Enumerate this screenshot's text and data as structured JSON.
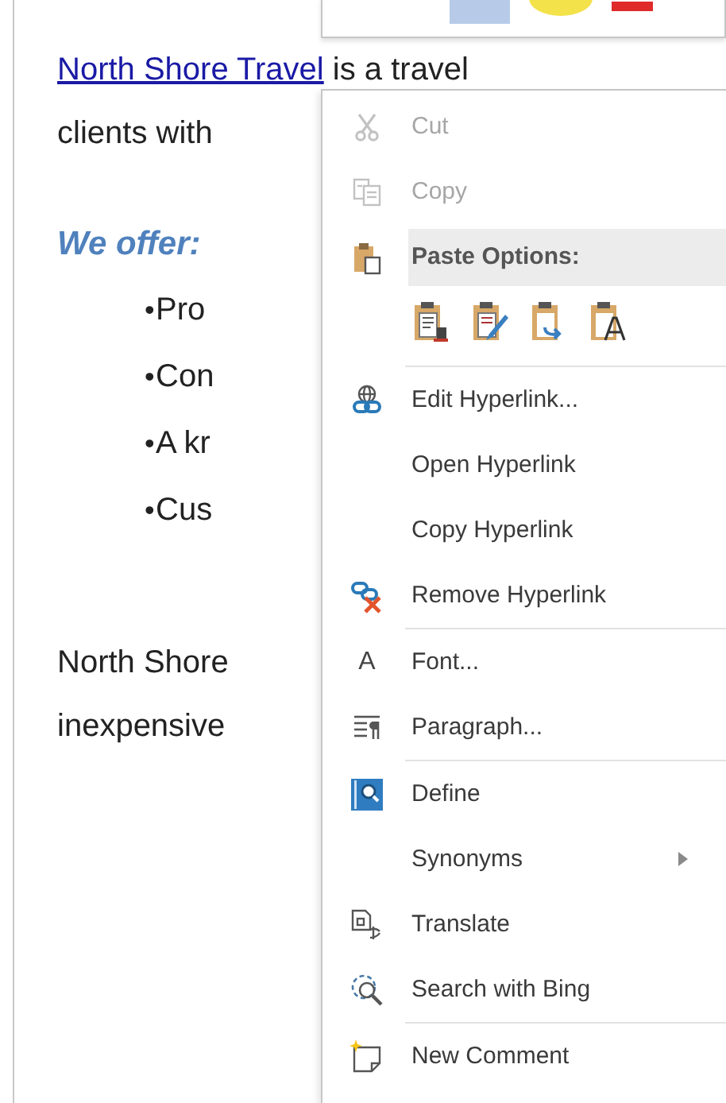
{
  "document": {
    "lines": [
      {
        "kind": "link",
        "link": "North Shore Travel",
        "text": "is a travel"
      },
      {
        "kind": "plain",
        "text": "clients with"
      },
      {
        "kind": "heading",
        "text": "We offer:"
      },
      {
        "kind": "bullet",
        "bullet": "•",
        "text": "Pro"
      },
      {
        "kind": "bullet",
        "bullet": "•",
        "text": "Con"
      },
      {
        "kind": "bullet",
        "bullet": "•",
        "text": "A kr"
      },
      {
        "kind": "bullet",
        "bullet": "•",
        "text": "Cus"
      },
      {
        "kind": "plain",
        "text": "North Shore"
      },
      {
        "kind": "plain",
        "text": "inexpensive"
      }
    ]
  },
  "menu": {
    "entries": [
      {
        "kind": "item",
        "label": "Cut",
        "disabled": true,
        "submenu": false
      },
      {
        "kind": "item",
        "label": "Copy",
        "disabled": true,
        "submenu": false
      },
      {
        "kind": "header",
        "label": "Paste Options:"
      },
      {
        "kind": "paste-icons"
      },
      {
        "kind": "separator"
      },
      {
        "kind": "item",
        "label": "Edit Hyperlink...",
        "disabled": false,
        "submenu": false
      },
      {
        "kind": "item",
        "label": "Open Hyperlink",
        "disabled": false,
        "submenu": false
      },
      {
        "kind": "item",
        "label": "Copy Hyperlink",
        "disabled": false,
        "submenu": false
      },
      {
        "kind": "item",
        "label": "Remove Hyperlink",
        "disabled": false,
        "submenu": false
      },
      {
        "kind": "separator"
      },
      {
        "kind": "item",
        "label": "Font...",
        "glyph": "A",
        "disabled": false,
        "submenu": false
      },
      {
        "kind": "item",
        "label": "Paragraph...",
        "disabled": false,
        "submenu": false
      },
      {
        "kind": "separator"
      },
      {
        "kind": "item",
        "label": "Define",
        "disabled": false,
        "submenu": false
      },
      {
        "kind": "item",
        "label": "Synonyms",
        "disabled": false,
        "submenu": true
      },
      {
        "kind": "item",
        "label": "Translate",
        "disabled": false,
        "submenu": false
      },
      {
        "kind": "item",
        "label": "Search with Bing",
        "disabled": false,
        "submenu": false
      },
      {
        "kind": "separator"
      },
      {
        "kind": "item",
        "label": "New Comment",
        "disabled": false,
        "submenu": false
      }
    ]
  }
}
